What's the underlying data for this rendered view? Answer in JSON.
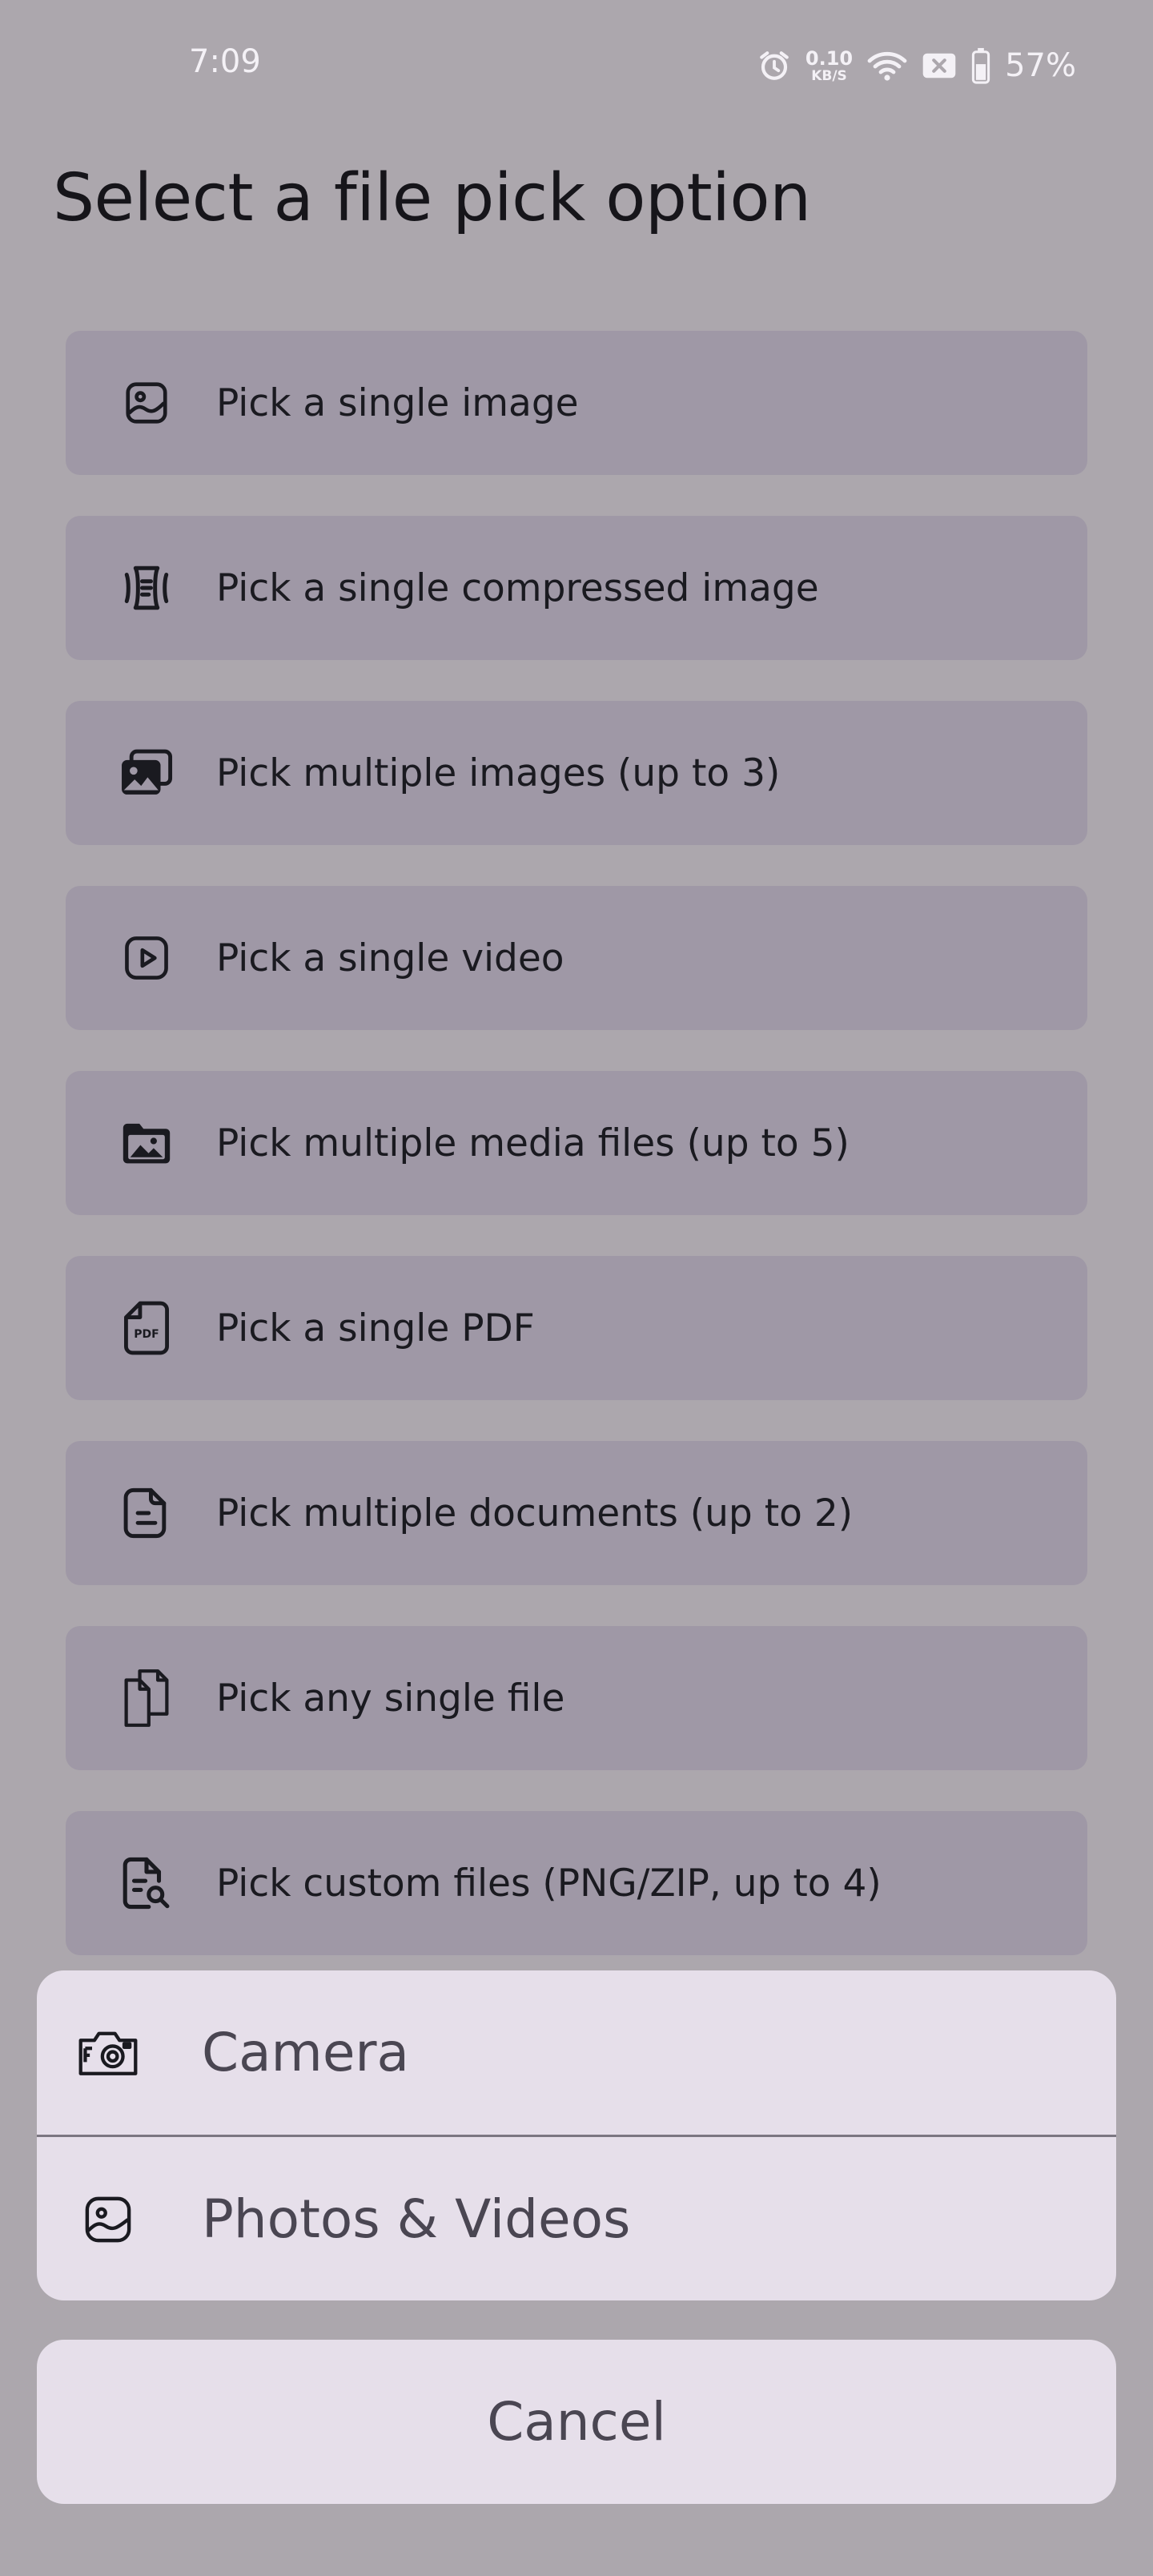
{
  "status_bar": {
    "time": "7:09",
    "net_speed_value": "0.10",
    "net_speed_unit": "KB/S",
    "battery_percent": "57%",
    "icons": [
      "alarm-icon",
      "wifi-icon",
      "sim-off-icon",
      "battery-icon"
    ]
  },
  "header": {
    "title": "Select a file pick option"
  },
  "options": [
    {
      "label": "Pick a single image",
      "icon": "image-icon"
    },
    {
      "label": "Pick a single compressed image",
      "icon": "compress-icon"
    },
    {
      "label": "Pick multiple images (up to 3)",
      "icon": "images-icon"
    },
    {
      "label": "Pick a single video",
      "icon": "video-icon"
    },
    {
      "label": "Pick multiple media files (up to 5)",
      "icon": "media-folder-icon"
    },
    {
      "label": "Pick a single PDF",
      "icon": "pdf-icon"
    },
    {
      "label": "Pick multiple documents (up to 2)",
      "icon": "document-icon"
    },
    {
      "label": "Pick any single file",
      "icon": "files-icon"
    },
    {
      "label": "Pick custom files (PNG/ZIP, up to 4)",
      "icon": "file-search-icon"
    }
  ],
  "sheet": {
    "camera_label": "Camera",
    "photos_label": "Photos & Videos",
    "cancel_label": "Cancel"
  },
  "colors": {
    "scrim_background": "#aca7ad",
    "option_background": "#9f98a6",
    "sheet_background": "#e6dfea"
  }
}
